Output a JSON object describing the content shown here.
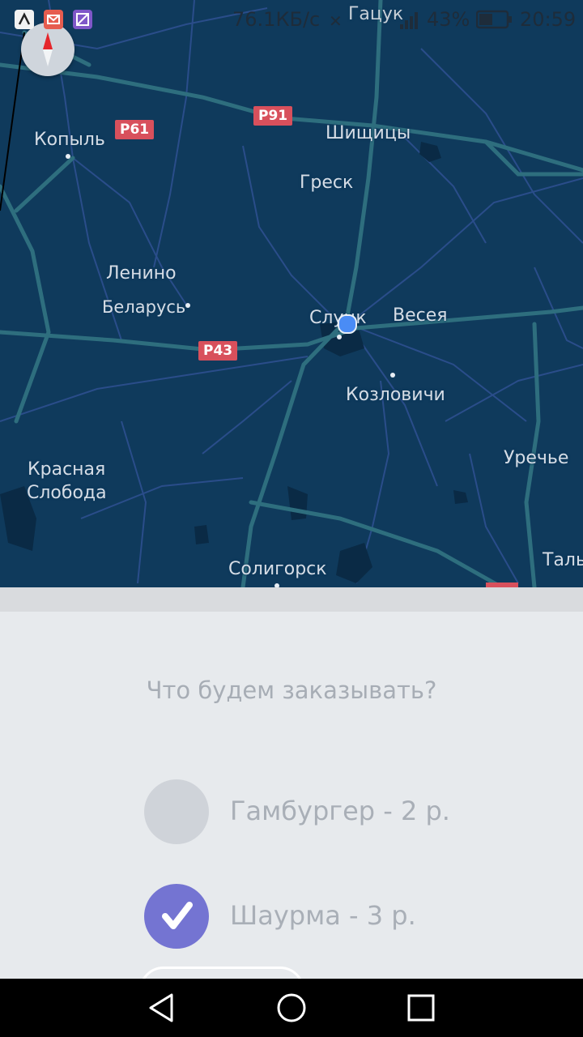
{
  "status_bar": {
    "network_speed": "76.1КБ/с",
    "battery": "43%",
    "time": "20:59",
    "map_overlap_label": "Гацук"
  },
  "map": {
    "places": {
      "kopyl": "Копыль",
      "shishitsy": "Шищицы",
      "gresk": "Греск",
      "lenino": "Ленино",
      "belarus": "Беларусь",
      "slutsk": "Слуцк",
      "vesya": "Весея",
      "kozlovichi": "Козловичи",
      "urechye": "Уречье",
      "krasnaya_sloboda_1": "Красная",
      "krasnaya_sloboda_2": "Слобода",
      "soligorsk": "Солигорск",
      "tal": "Таль"
    },
    "shields": {
      "p61": "P61",
      "p91": "P91",
      "p43": "P43"
    },
    "colors": {
      "land": "#0f3a5c",
      "road": "#2e6e7e",
      "minor_road": "#2a4d8a",
      "shield": "#d8505c",
      "my_location": "#4a8cf5"
    }
  },
  "order": {
    "question": "Что будем заказывать?",
    "options": [
      {
        "label": "Гамбургер - 2 р.",
        "selected": false
      },
      {
        "label": "Шаурма - 3 р.",
        "selected": true
      }
    ],
    "accent_color": "#7474d2"
  },
  "nav": {
    "back": "back-icon",
    "home": "home-icon",
    "recents": "recents-icon"
  }
}
